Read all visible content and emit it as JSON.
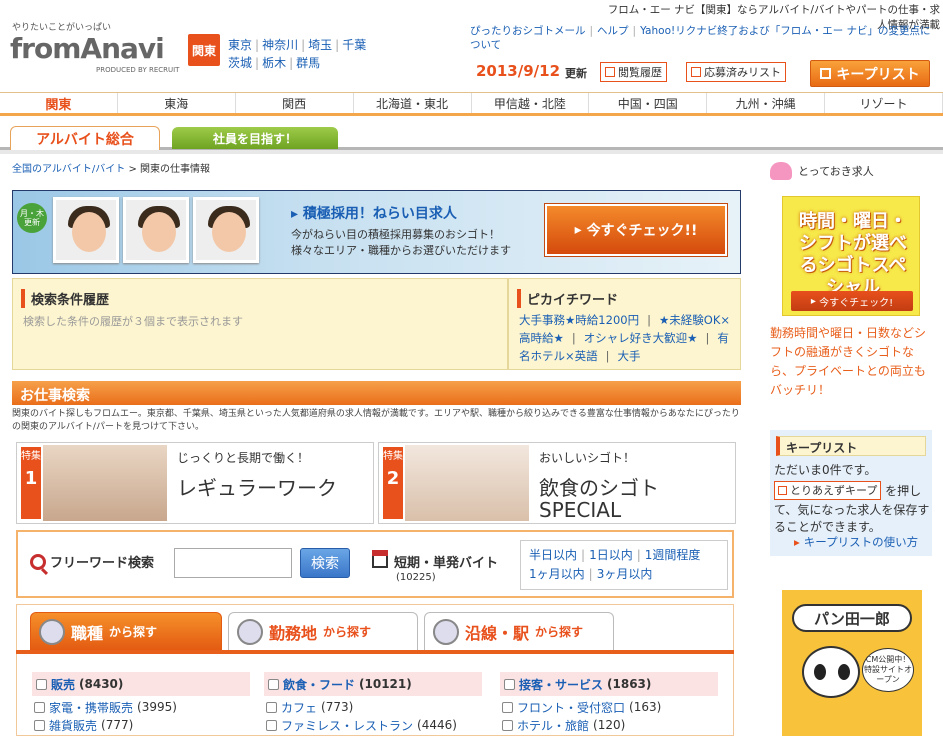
{
  "header": {
    "tagline": "フロム・エー ナビ【関東】ならアルバイト/バイトやパートの仕事・求人情報が満載",
    "logo_sub": "やりたいことがいっぱい",
    "logo_main": "fromAnavi",
    "logo_produced": "PRODUCED BY RECRUIT",
    "region_badge": "関東",
    "prefs": [
      "東京",
      "神奈川",
      "埼玉",
      "千葉",
      "茨城",
      "栃木",
      "群馬"
    ],
    "links": [
      "ぴったりおシゴトメール",
      "ヘルプ",
      "Yahoo!リクナビ終了および「フロム・エー ナビ」の変更点について"
    ],
    "date": "2013/9/12",
    "date_suffix": "更新",
    "history_btn": "閲覧履歴",
    "applied_btn": "応募済みリスト",
    "keep_btn": "キープリスト"
  },
  "region_nav": [
    "関東",
    "東海",
    "関西",
    "北海道・東北",
    "甲信越・北陸",
    "中国・四国",
    "九州・沖縄",
    "リゾート"
  ],
  "tabs": {
    "tab1": "アルバイト総合",
    "tab2": "社員を目指す！"
  },
  "breadcrumb": {
    "home": "全国のアルバイト/バイト",
    "sep": ">",
    "current": "関東の仕事情報"
  },
  "banner": {
    "badge": "月・木 更新",
    "title": "積極採用！ねらい目求人",
    "text1": "今がねらい目の積極採用募集のおシゴト！",
    "text2": "様々なエリア・職種からお選びいただけます",
    "cta": "今すぐチェック!!"
  },
  "history": {
    "title": "検索条件履歴",
    "text": "検索した条件の履歴が３個まで表示されます"
  },
  "pickup": {
    "title": "ピカイチワード",
    "words": [
      "大手事務★時給1200円",
      "★未経験OK×高時給★",
      "オシャレ好き大歓迎★",
      "有名ホテル×英語",
      "大手"
    ]
  },
  "search": {
    "title": "お仕事検索",
    "desc": "関東のバイト探しもフロムエー。東京都、千葉県、埼玉県といった人気都道府県の求人情報が満載です。エリアや駅、職種から絞り込みできる豊富な仕事情報からあなたにぴったりの関東のアルバイト/パートを見つけて下さい。",
    "feature1": {
      "label": "特集",
      "num": "1",
      "sub": "じっくりと長期で働く！",
      "main": "レギュラーワーク"
    },
    "feature2": {
      "label": "特集",
      "num": "2",
      "sub": "おいしいシゴト！",
      "main1": "飲食のシゴト",
      "main2": "SPECIAL"
    },
    "freeword_label": "フリーワード検索",
    "freeword_value": "",
    "search_btn": "検索",
    "short_label": "短期・単発バイト",
    "short_count": "(10225)",
    "periods": [
      "半日以内",
      "1日以内",
      "1週間程度",
      "1ヶ月以内",
      "3ヶ月以内"
    ]
  },
  "category_tabs": [
    {
      "main": "職種",
      "sub": "から探す"
    },
    {
      "main": "勤務地",
      "sub": "から探す"
    },
    {
      "main": "沿線・駅",
      "sub": "から探す"
    }
  ],
  "categories": [
    {
      "name": "販売",
      "count": "(8430)",
      "items": [
        {
          "name": "家電・携帯販売",
          "count": "(3995)"
        },
        {
          "name": "雑貨販売",
          "count": "(777)"
        }
      ]
    },
    {
      "name": "飲食・フード",
      "count": "(10121)",
      "items": [
        {
          "name": "カフェ",
          "count": "(773)"
        },
        {
          "name": "ファミレス・レストラン",
          "count": "(4446)"
        }
      ]
    },
    {
      "name": "接客・サービス",
      "count": "(1863)",
      "items": [
        {
          "name": "フロント・受付窓口",
          "count": "(163)"
        },
        {
          "name": "ホテル・旅館",
          "count": "(120)"
        }
      ]
    }
  ],
  "sidebar": {
    "heading": "とっておき求人",
    "special_title": "時間・曜日・シフトが選べるシゴトスペシャル",
    "special_btn": "今すぐチェック!",
    "desc": "勤務時間や曜日・日数などシフトの融通がきくシゴトなら、プライベートとの両立もバッチリ！",
    "keep_title": "キープリスト",
    "keep_count": "ただいま0件です。",
    "keep_btn": "とりあえずキープ",
    "keep_after": "を押して、気になった求人を保存することができます。",
    "keep_how": "キープリストの使い方",
    "panda_title": "パン田一郎",
    "panda_bubble": "CM公開中！特設サイトオープン"
  },
  "colors": {
    "accent": "#e8501c",
    "link": "#1a5fb4",
    "highlight_bg": "#fdf5cf"
  }
}
